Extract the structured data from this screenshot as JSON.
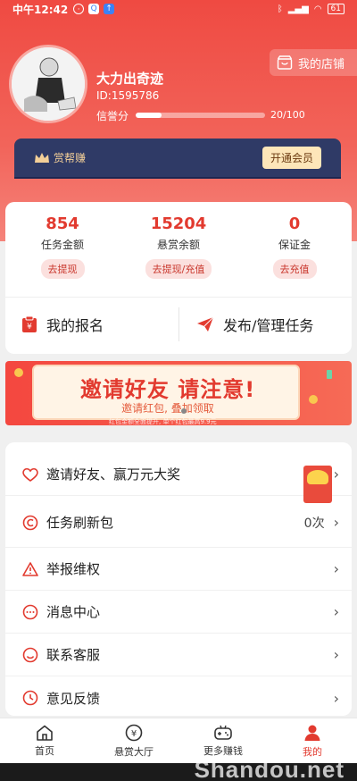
{
  "status_bar": {
    "time": "中午12:42",
    "battery": "61"
  },
  "profile": {
    "name": "大力出奇迹",
    "id_text": "ID:1595786",
    "credit_label": "信誉分",
    "credit_value": "20/100",
    "credit_fraction": 0.2,
    "shop_label": "我的店铺"
  },
  "vip": {
    "title": "赏帮赚",
    "button": "开通会员"
  },
  "stats": [
    {
      "value": "854",
      "label": "任务金额",
      "action": "去提现"
    },
    {
      "value": "15204",
      "label": "悬赏余额",
      "action": "去提现/充值"
    },
    {
      "value": "0",
      "label": "保证金",
      "action": "去充值"
    }
  ],
  "quick_actions": {
    "signup": "我的报名",
    "publish": "发布/管理任务"
  },
  "banner": {
    "headline": "邀请好友 请注意!",
    "sub": "邀请红包, 叠加领取",
    "tip": "红包金额全面提升, 单个红包最高9.9元"
  },
  "menu": [
    {
      "label": "邀请好友、赢万元大奖",
      "icon": "heart-icon",
      "value": ""
    },
    {
      "label": "任务刷新包",
      "icon": "refresh-coin-icon",
      "value": "0次"
    },
    {
      "label": "举报维权",
      "icon": "warning-icon",
      "value": ""
    },
    {
      "label": "消息中心",
      "icon": "message-icon",
      "value": ""
    },
    {
      "label": "联系客服",
      "icon": "service-icon",
      "value": ""
    },
    {
      "label": "意见反馈",
      "icon": "clock-icon",
      "value": ""
    }
  ],
  "tabs": [
    {
      "label": "首页",
      "icon": "home-icon"
    },
    {
      "label": "悬赏大厅",
      "icon": "yen-coin-icon"
    },
    {
      "label": "更多赚钱",
      "icon": "gamepad-icon"
    },
    {
      "label": "我的",
      "icon": "person-icon"
    }
  ],
  "watermark": "Shandou.net",
  "colors": {
    "primary": "#e23a2f",
    "header": "#ef4a42",
    "vip_bg": "#2f3a66",
    "vip_text": "#f3cf98"
  }
}
